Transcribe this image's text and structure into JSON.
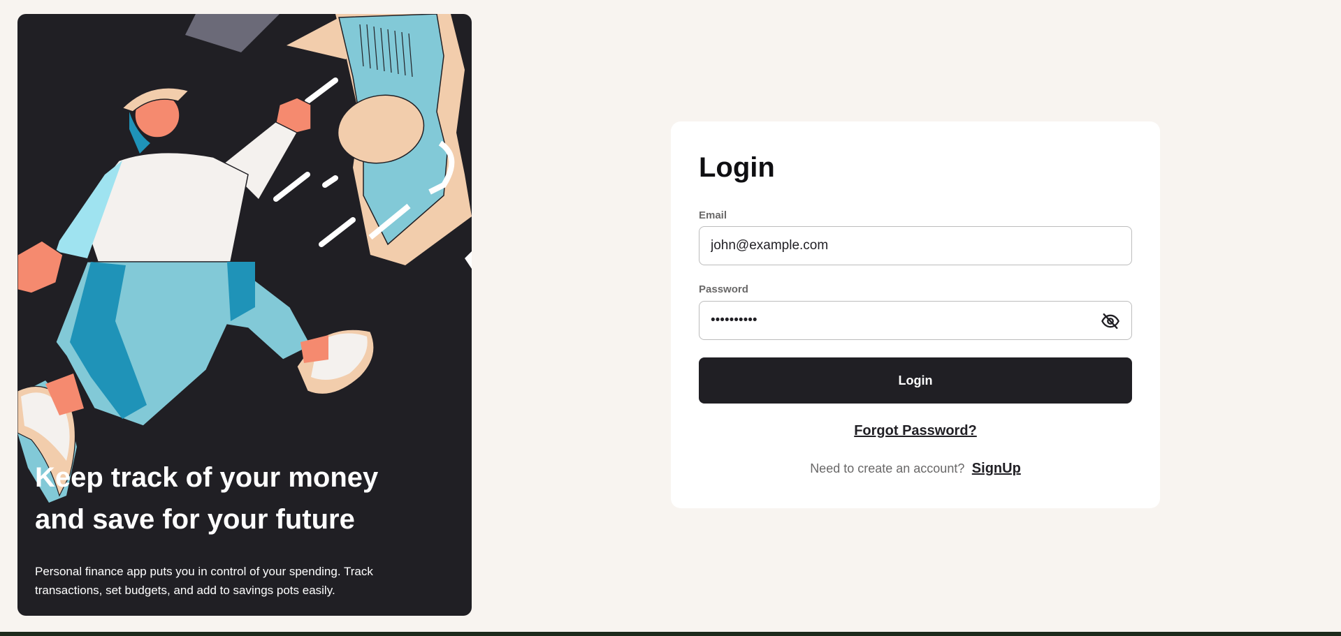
{
  "hero": {
    "title": "Keep track of your money and save for your future",
    "description": "Personal finance app puts you in control of your spending. Track transactions, set budgets, and add to savings pots easily."
  },
  "login": {
    "title": "Login",
    "email": {
      "label": "Email",
      "value": "john@example.com"
    },
    "password": {
      "label": "Password",
      "value": "••••••••••",
      "toggle_icon": "eye-slash-icon"
    },
    "submit_label": "Login",
    "forgot_password": "Forgot Password?",
    "signup_prompt": "Need to create an account?",
    "signup_link": "SignUp"
  },
  "colors": {
    "page_background": "#f8f4f0",
    "panel_dark": "#201f24",
    "card": "#ffffff",
    "text_muted": "#696868",
    "accent_teal": "#82c9d7",
    "accent_salmon": "#f58a6f",
    "accent_beige": "#f2cdac"
  }
}
